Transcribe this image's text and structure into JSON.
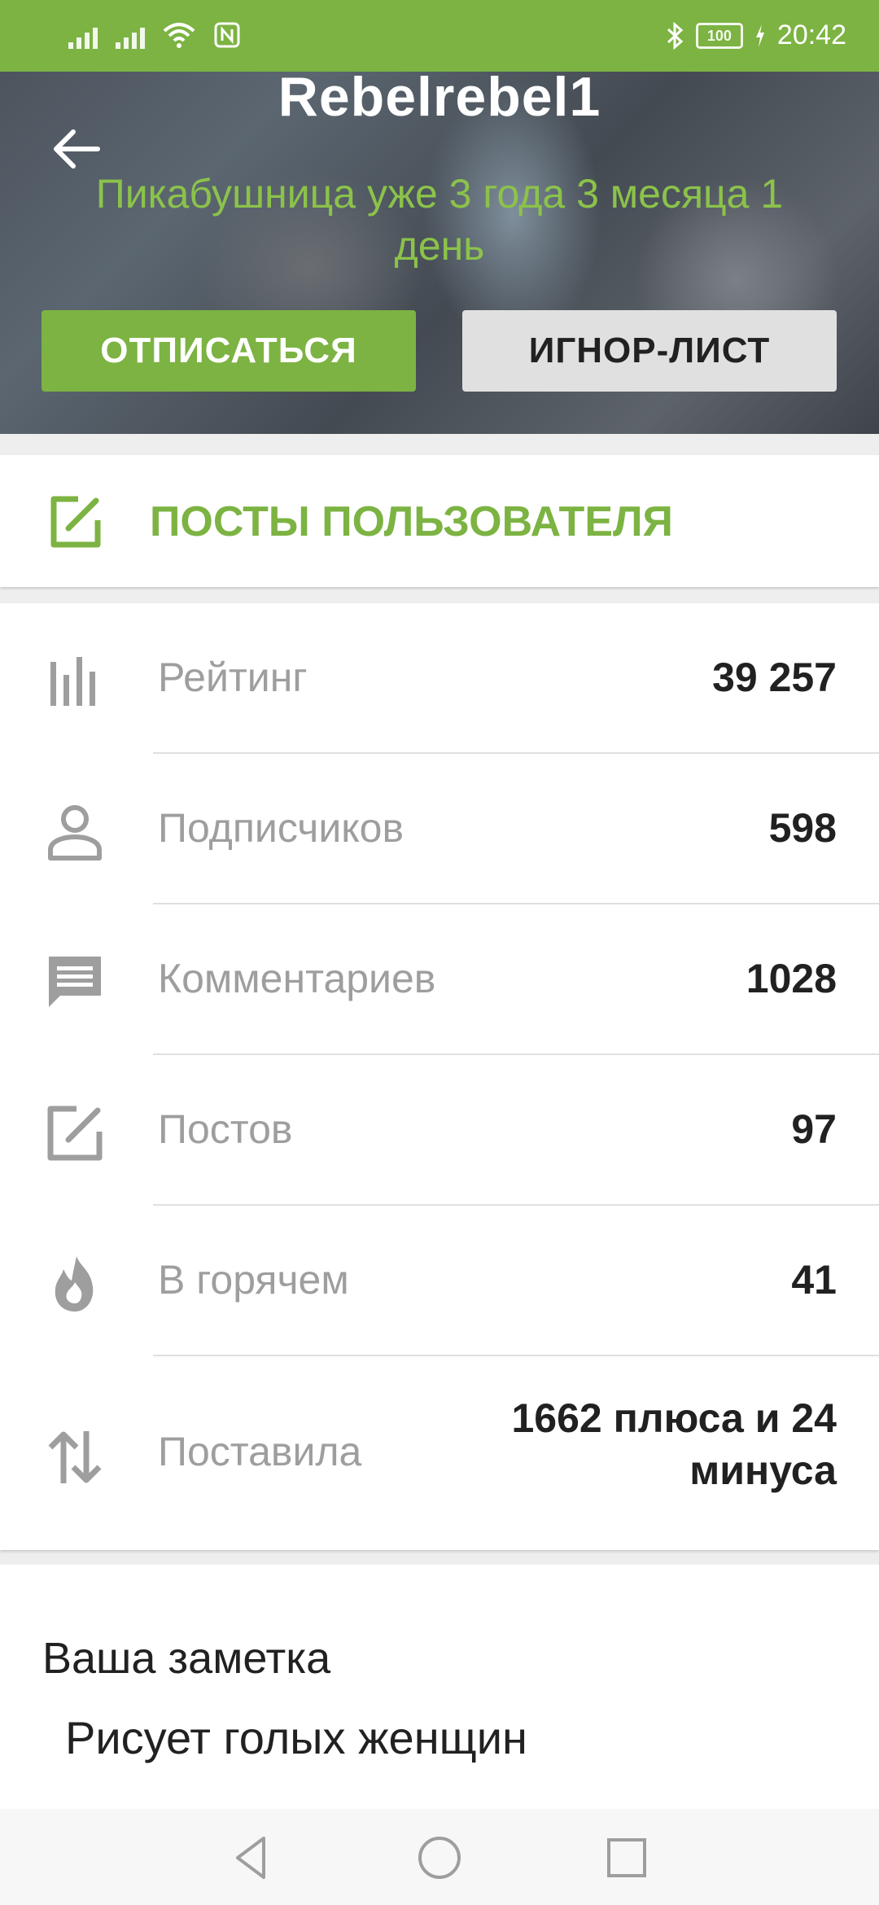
{
  "status_bar": {
    "time": "20:42",
    "battery": "100",
    "icons": [
      "signal-icon",
      "signal-icon",
      "wifi-icon",
      "nfc-icon",
      "bluetooth-icon",
      "battery-icon",
      "charging-icon"
    ]
  },
  "profile": {
    "username": "Rebelrebel1",
    "member_since": "Пикабушница уже 3 года 3 месяца 1 день",
    "unsubscribe_label": "ОТПИСАТЬСЯ",
    "ignore_label": "ИГНОР-ЛИСТ"
  },
  "posts_link": {
    "label": "ПОСТЫ ПОЛЬЗОВАТЕЛЯ"
  },
  "stats": {
    "rows": [
      {
        "label": "Рейтинг",
        "value": "39 257",
        "icon": "rating-bars-icon"
      },
      {
        "label": "Подписчиков",
        "value": "598",
        "icon": "person-icon"
      },
      {
        "label": "Комментариев",
        "value": "1028",
        "icon": "comment-icon"
      },
      {
        "label": "Постов",
        "value": "97",
        "icon": "edit-square-icon"
      },
      {
        "label": "В горячем",
        "value": "41",
        "icon": "hot-flame-icon"
      },
      {
        "label": "Поставила",
        "value": "1662 плюса и 24 минуса",
        "icon": "swap-vertical-icon"
      }
    ]
  },
  "note": {
    "title": "Ваша заметка",
    "text": "Рисует голых женщин"
  },
  "colors": {
    "accent": "#7cb342",
    "accent_text": "#8bc34a",
    "label_grey": "#9e9e9e",
    "value_dark": "#212121"
  }
}
